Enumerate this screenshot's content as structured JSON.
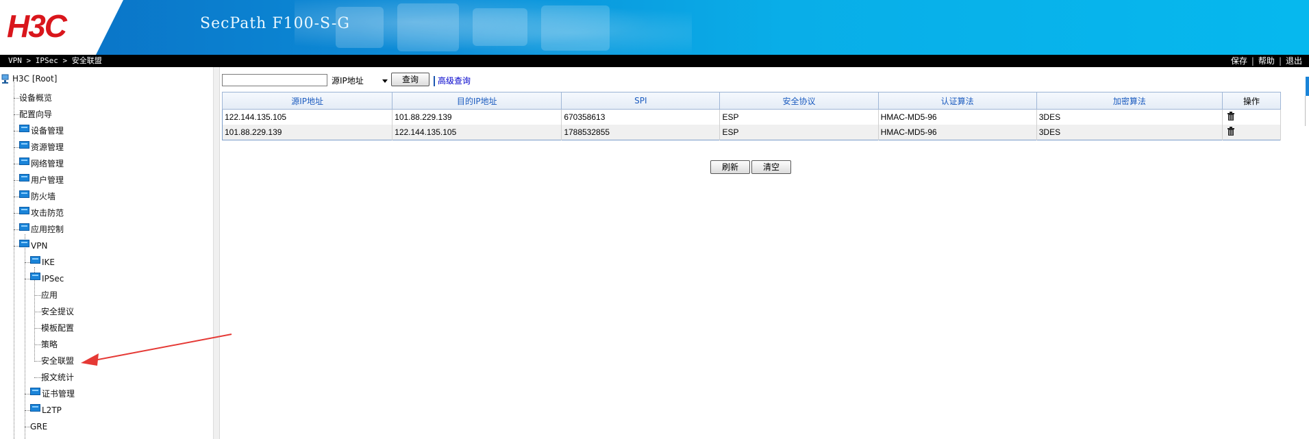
{
  "header": {
    "logo": "H3C",
    "product": "SecPath F100-S-G"
  },
  "topbar": {
    "breadcrumb": [
      "VPN",
      "IPSec",
      "安全联盟"
    ],
    "links": [
      "保存",
      "帮助",
      "退出"
    ]
  },
  "sidebar": {
    "root": "H3C [Root]",
    "items": [
      {
        "label": "设备概览",
        "level": 1,
        "folder": false
      },
      {
        "label": "配置向导",
        "level": 1,
        "folder": false
      },
      {
        "label": "设备管理",
        "level": 1,
        "folder": true
      },
      {
        "label": "资源管理",
        "level": 1,
        "folder": true
      },
      {
        "label": "网络管理",
        "level": 1,
        "folder": true
      },
      {
        "label": "用户管理",
        "level": 1,
        "folder": true
      },
      {
        "label": "防火墙",
        "level": 1,
        "folder": true
      },
      {
        "label": "攻击防范",
        "level": 1,
        "folder": true
      },
      {
        "label": "应用控制",
        "level": 1,
        "folder": true
      },
      {
        "label": "VPN",
        "level": 1,
        "folder": true
      },
      {
        "label": "IKE",
        "level": 2,
        "folder": true
      },
      {
        "label": "IPSec",
        "level": 2,
        "folder": true
      },
      {
        "label": "应用",
        "level": 3,
        "folder": false
      },
      {
        "label": "安全提议",
        "level": 3,
        "folder": false
      },
      {
        "label": "模板配置",
        "level": 3,
        "folder": false
      },
      {
        "label": "策略",
        "level": 3,
        "folder": false
      },
      {
        "label": "安全联盟",
        "level": 3,
        "folder": false
      },
      {
        "label": "报文统计",
        "level": 3,
        "folder": false
      },
      {
        "label": "证书管理",
        "level": 2,
        "folder": true
      },
      {
        "label": "L2TP",
        "level": 2,
        "folder": true
      },
      {
        "label": "GRE",
        "level": 2,
        "folder": false
      }
    ]
  },
  "search": {
    "value": "",
    "field_selected": "源IP地址",
    "query_label": "查询",
    "advanced_label": "高级查询"
  },
  "table": {
    "headers": [
      "源IP地址",
      "目的IP地址",
      "SPI",
      "安全协议",
      "认证算法",
      "加密算法",
      "操作"
    ],
    "rows": [
      [
        "122.144.135.105",
        "101.88.229.139",
        "670358613",
        "ESP",
        "HMAC-MD5-96",
        "3DES"
      ],
      [
        "101.88.229.139",
        "122.144.135.105",
        "1788532855",
        "ESP",
        "HMAC-MD5-96",
        "3DES"
      ]
    ]
  },
  "actions": {
    "refresh_label": "刷新",
    "clear_label": "清空"
  },
  "colors": {
    "brand_red": "#d9161c",
    "header_blue": "#09aee8",
    "header_link": "#1b5bbf",
    "annotation_red": "#e53935"
  }
}
